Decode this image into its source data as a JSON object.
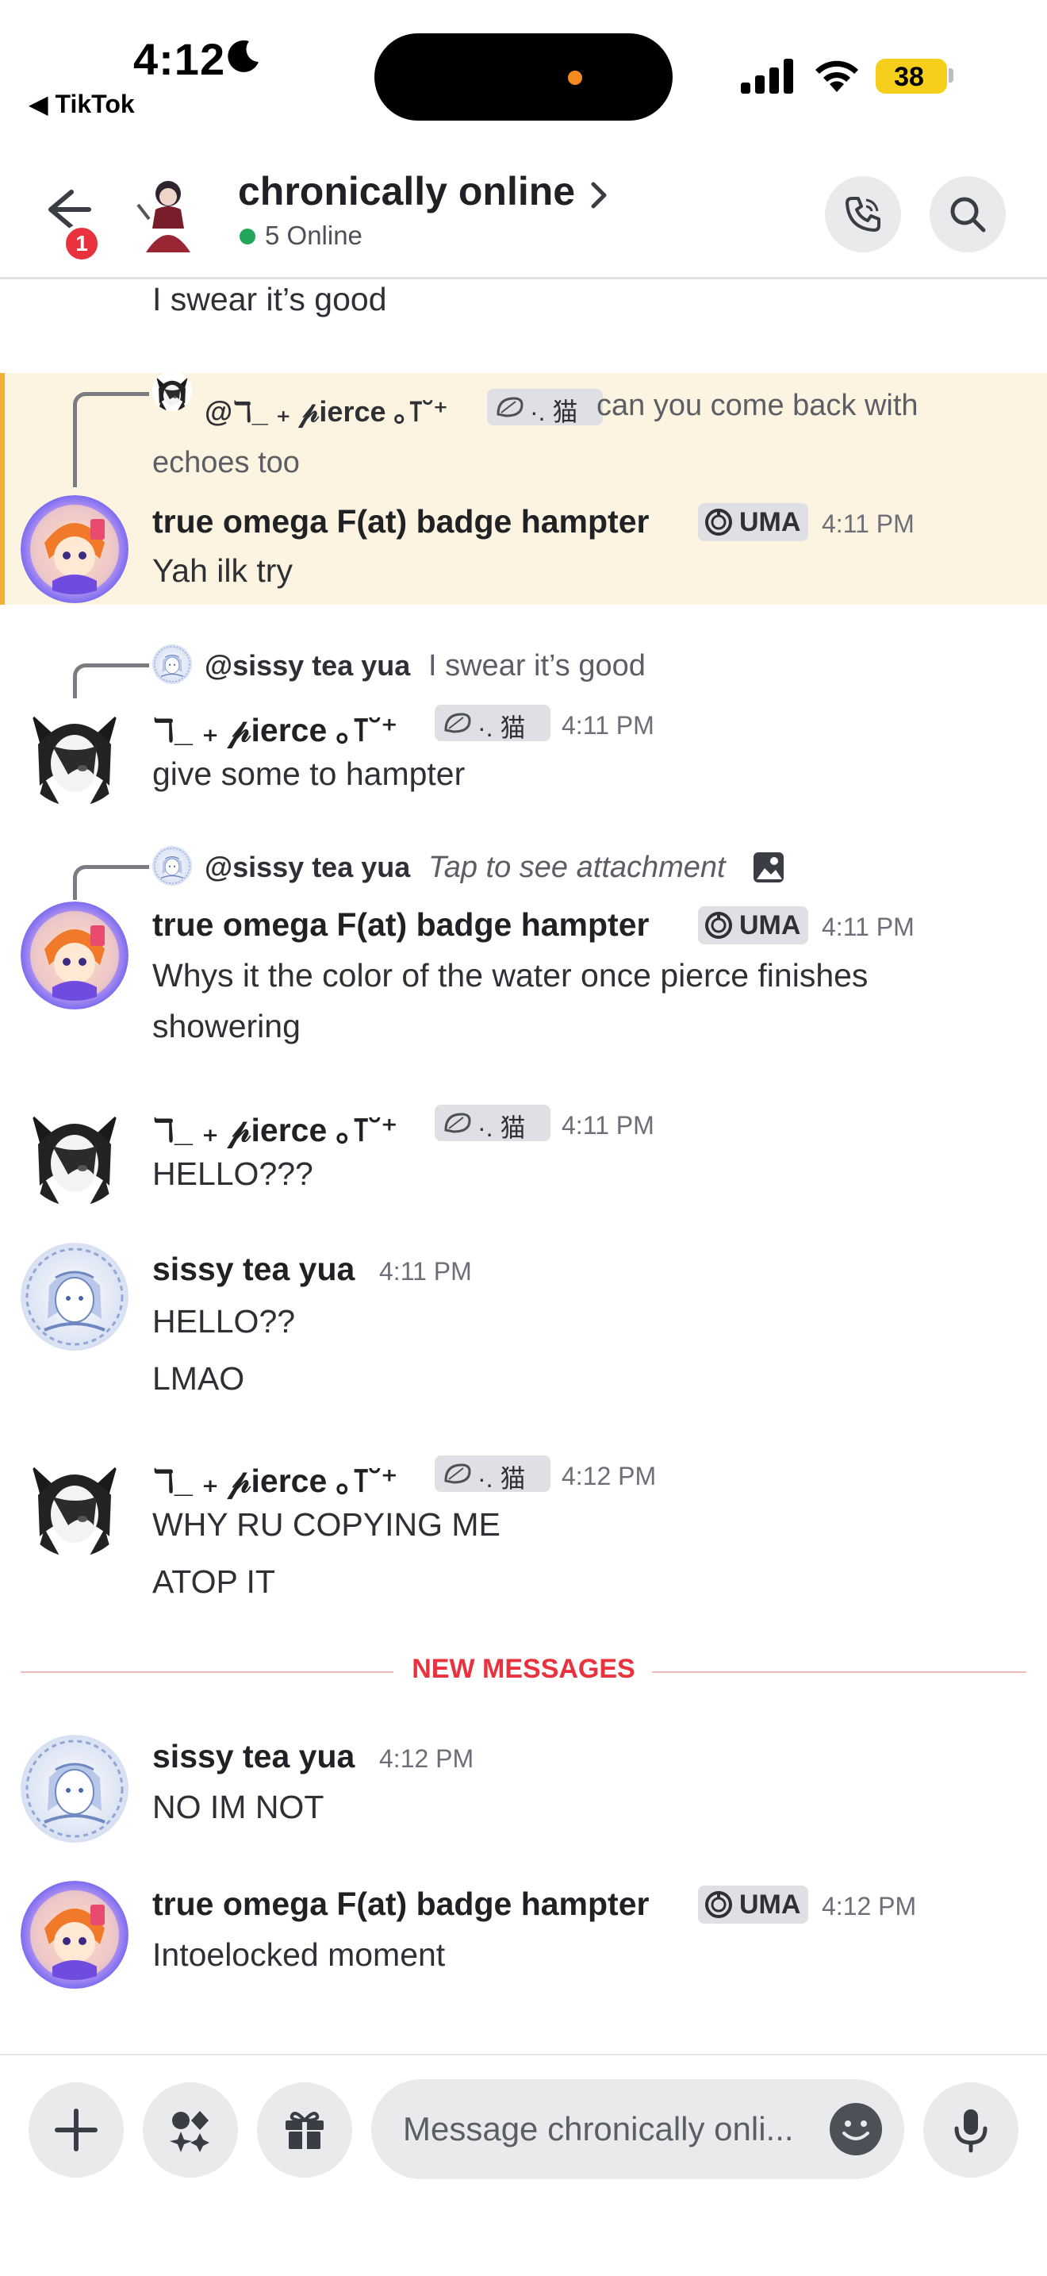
{
  "status_bar": {
    "time": "4:12",
    "back_app": "TikTok",
    "battery": "38"
  },
  "header": {
    "title": "chronically online",
    "online": "5 Online",
    "notification_count": "1"
  },
  "tag_uma": "UMA",
  "tag_cat": "·. 猫",
  "pierce_name": "ℸ_ ₊ 𝓅ierce ｡⊺˘⁺",
  "messages": {
    "m0": {
      "text": "I swear it’s good"
    },
    "m1": {
      "reply_name": "@ℸ_ ₊ 𝓅ierce ｡⊺˘⁺",
      "reply_text_1": "can you come back with",
      "reply_text_2": "echoes too",
      "author": "true omega F(at) badge hampter",
      "time": "4:11 PM",
      "text": "Yah ilk try"
    },
    "m2": {
      "reply_name": "@sissy tea yua",
      "reply_text": "I swear it’s good",
      "time": "4:11 PM",
      "text": "give some to hampter"
    },
    "m3": {
      "reply_name": "@sissy tea yua",
      "reply_text": "Tap to see attachment",
      "author": "true omega F(at) badge hampter",
      "time": "4:11 PM",
      "text_1": "Whys it the color of the water once pierce finishes",
      "text_2": "showering"
    },
    "m4": {
      "time": "4:11 PM",
      "text": "HELLO???"
    },
    "m5": {
      "author": "sissy tea yua",
      "time": "4:11 PM",
      "text_1": "HELLO??",
      "text_2": "LMAO"
    },
    "m6": {
      "time": "4:12 PM",
      "text_1": "WHY RU COPYING ME",
      "text_2": "ATOP IT"
    },
    "divider": "NEW MESSAGES",
    "m7": {
      "author": "sissy tea yua",
      "time": "4:12 PM",
      "text": "NO IM NOT"
    },
    "m8": {
      "author": "true omega F(at) badge hampter",
      "time": "4:12 PM",
      "text": "Intoelocked moment"
    }
  },
  "composer": {
    "placeholder": "Message chronically onli..."
  },
  "colors": {
    "accent_red": "#e8323e",
    "online_green": "#23a55a",
    "highlight": "#fcf4e1",
    "highlight_bar": "#f0b232"
  }
}
